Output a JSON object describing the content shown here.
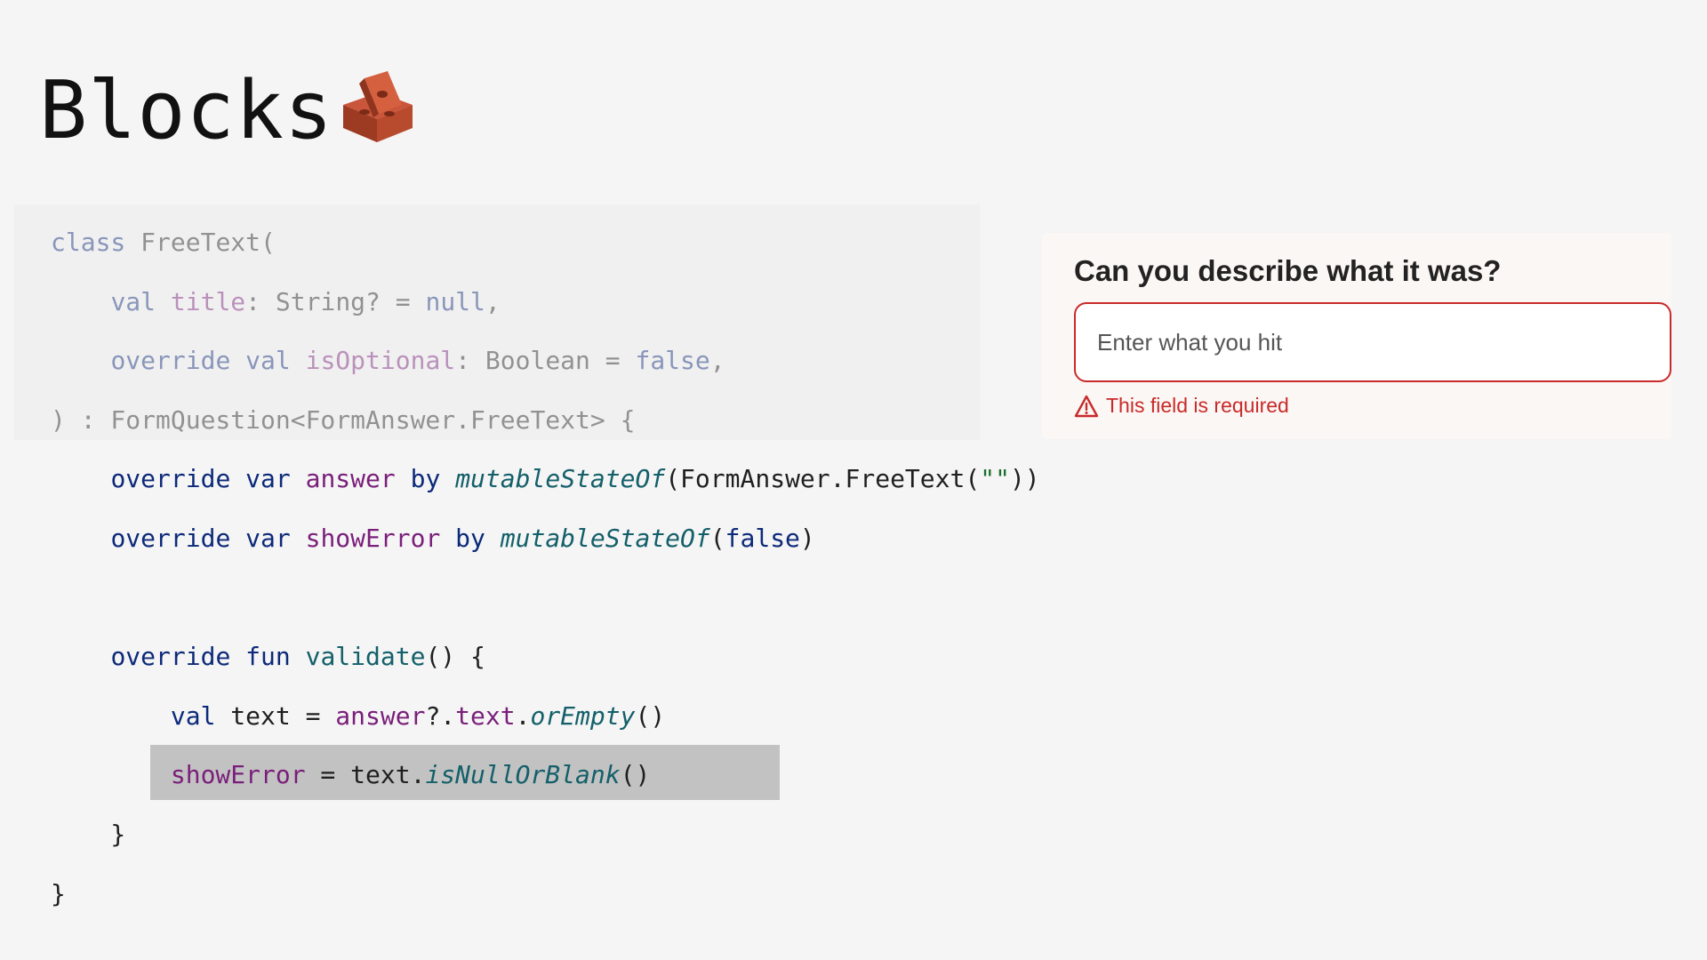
{
  "slide": {
    "title": "Blocks",
    "title_icon": "brick-icon"
  },
  "code": {
    "dimmed_lines": [
      0,
      1,
      2,
      3
    ],
    "highlighted_line": 9,
    "lines": [
      [
        {
          "t": "class",
          "c": "kw"
        },
        {
          "t": " FreeText(",
          "c": "plain"
        }
      ],
      [
        {
          "t": "    ",
          "c": "plain"
        },
        {
          "t": "val",
          "c": "kw"
        },
        {
          "t": " ",
          "c": "plain"
        },
        {
          "t": "title",
          "c": "prop"
        },
        {
          "t": ": String? = ",
          "c": "plain"
        },
        {
          "t": "null",
          "c": "kw"
        },
        {
          "t": ",",
          "c": "plain"
        }
      ],
      [
        {
          "t": "    ",
          "c": "plain"
        },
        {
          "t": "override val",
          "c": "kw"
        },
        {
          "t": " ",
          "c": "plain"
        },
        {
          "t": "isOptional",
          "c": "prop"
        },
        {
          "t": ": Boolean = ",
          "c": "plain"
        },
        {
          "t": "false",
          "c": "kw"
        },
        {
          "t": ",",
          "c": "plain"
        }
      ],
      [
        {
          "t": ") : FormQuestion<FormAnswer.FreeText> {",
          "c": "plain"
        }
      ],
      [
        {
          "t": "    ",
          "c": "plain"
        },
        {
          "t": "override var",
          "c": "kw"
        },
        {
          "t": " ",
          "c": "plain"
        },
        {
          "t": "answer",
          "c": "prop"
        },
        {
          "t": " ",
          "c": "plain"
        },
        {
          "t": "by",
          "c": "kw"
        },
        {
          "t": " ",
          "c": "plain"
        },
        {
          "t": "mutableStateOf",
          "c": "fn ital"
        },
        {
          "t": "(FormAnswer.FreeText(",
          "c": "plain"
        },
        {
          "t": "\"\"",
          "c": "str"
        },
        {
          "t": "))",
          "c": "plain"
        }
      ],
      [
        {
          "t": "    ",
          "c": "plain"
        },
        {
          "t": "override var",
          "c": "kw"
        },
        {
          "t": " ",
          "c": "plain"
        },
        {
          "t": "showError",
          "c": "prop"
        },
        {
          "t": " ",
          "c": "plain"
        },
        {
          "t": "by",
          "c": "kw"
        },
        {
          "t": " ",
          "c": "plain"
        },
        {
          "t": "mutableStateOf",
          "c": "fn ital"
        },
        {
          "t": "(",
          "c": "plain"
        },
        {
          "t": "false",
          "c": "kw"
        },
        {
          "t": ")",
          "c": "plain"
        }
      ],
      [
        {
          "t": "",
          "c": "plain"
        }
      ],
      [
        {
          "t": "    ",
          "c": "plain"
        },
        {
          "t": "override fun",
          "c": "kw"
        },
        {
          "t": " ",
          "c": "plain"
        },
        {
          "t": "validate",
          "c": "fn"
        },
        {
          "t": "() {",
          "c": "plain"
        }
      ],
      [
        {
          "t": "        ",
          "c": "plain"
        },
        {
          "t": "val",
          "c": "kw"
        },
        {
          "t": " text = ",
          "c": "plain"
        },
        {
          "t": "answer",
          "c": "prop"
        },
        {
          "t": "?.",
          "c": "plain"
        },
        {
          "t": "text",
          "c": "prop"
        },
        {
          "t": ".",
          "c": "plain"
        },
        {
          "t": "orEmpty",
          "c": "fn ital"
        },
        {
          "t": "()",
          "c": "plain"
        }
      ],
      [
        {
          "t": "        ",
          "c": "plain"
        },
        {
          "t": "showError",
          "c": "prop"
        },
        {
          "t": " = text.",
          "c": "plain"
        },
        {
          "t": "isNullOrBlank",
          "c": "fn ital"
        },
        {
          "t": "()",
          "c": "plain"
        }
      ],
      [
        {
          "t": "    }",
          "c": "plain"
        }
      ],
      [
        {
          "t": "}",
          "c": "plain"
        }
      ]
    ]
  },
  "form": {
    "question": "Can you describe what it was?",
    "input_placeholder": "Enter what you hit",
    "input_value": "",
    "error_text": "This field is required",
    "error_icon": "warning-triangle-icon",
    "error_color": "#c92a2a"
  }
}
